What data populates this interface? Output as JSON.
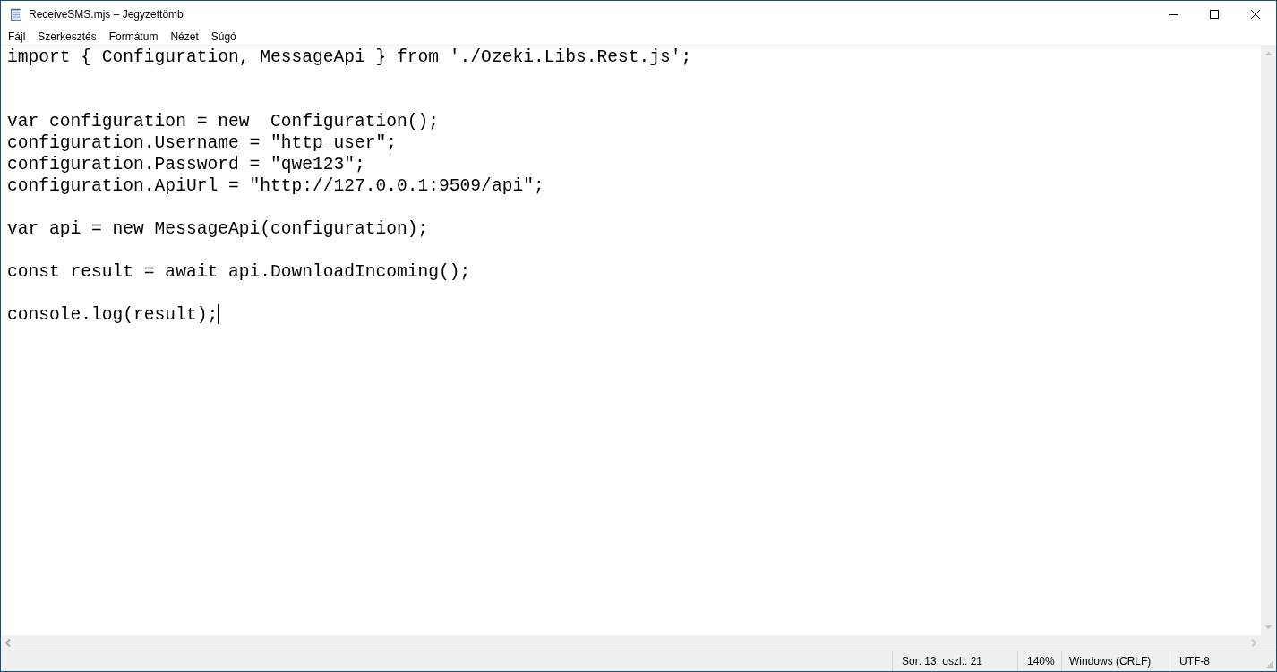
{
  "window": {
    "title": "ReceiveSMS.mjs – Jegyzettömb"
  },
  "menu": [
    "Fájl",
    "Szerkesztés",
    "Formátum",
    "Nézet",
    "Súgó"
  ],
  "editor": {
    "text": "import { Configuration, MessageApi } from './Ozeki.Libs.Rest.js';\n\n\nvar configuration = new  Configuration();\nconfiguration.Username = \"http_user\";\nconfiguration.Password = \"qwe123\";\nconfiguration.ApiUrl = \"http://127.0.0.1:9509/api\";\n\nvar api = new MessageApi(configuration);\n\nconst result = await api.DownloadIncoming();\n\nconsole.log(result);"
  },
  "status_bar": [
    "Sor: 13, oszl.: 21",
    "140%",
    "Windows (CRLF)",
    "UTF-8"
  ]
}
